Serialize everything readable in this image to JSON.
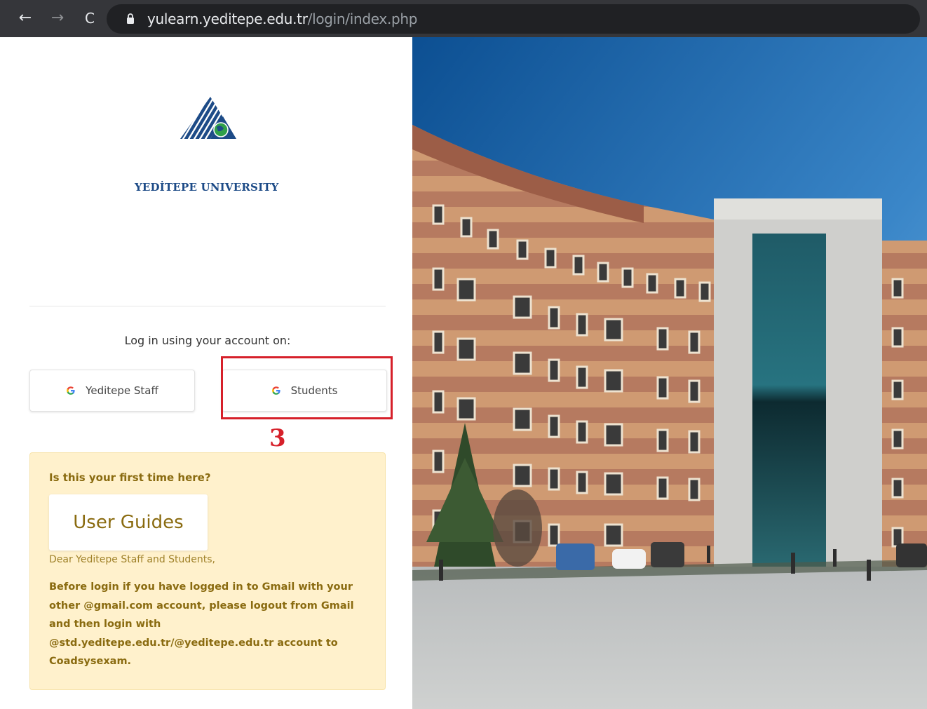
{
  "browser": {
    "url_domain": "yulearn.yeditepe.edu.tr",
    "url_path": "/login/index.php",
    "back_glyph": "←",
    "forward_glyph": "→",
    "reload_glyph": "C"
  },
  "logo": {
    "name": "YEDİTEPE UNIVERSITY"
  },
  "login": {
    "prompt": "Log in using your account on:",
    "providers": [
      {
        "label": "Yeditepe Staff",
        "icon": "google-g-icon"
      },
      {
        "label": "Students",
        "icon": "google-g-icon"
      }
    ]
  },
  "annotation": {
    "step": "3",
    "color": "#d6202a"
  },
  "info": {
    "heading": "Is this your first time here?",
    "guide_button": "User Guides",
    "greeting": "Dear Yeditepe Staff and Students,",
    "notice": "Before login if you have logged in to Gmail with your other @gmail.com account, please logout from Gmail and then login with @std.yeditepe.edu.tr/@yeditepe.edu.tr account to Coadsysexam."
  },
  "colors": {
    "info_bg": "#fff1cc",
    "info_text": "#8a6b10",
    "logo_blue": "#1d4b87"
  }
}
